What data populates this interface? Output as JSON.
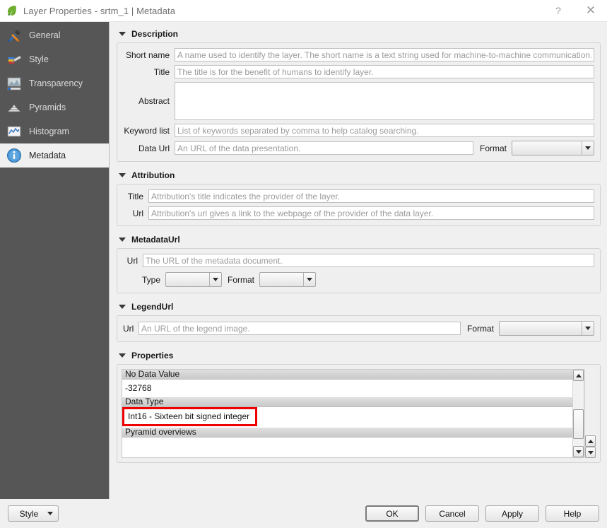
{
  "window": {
    "title": "Layer Properties - srtm_1 | Metadata",
    "icon": "qgis-leaf-icon",
    "help_button": "?",
    "close_button": "✕"
  },
  "sidebar": {
    "items": [
      {
        "label": "General",
        "icon": "hammer-screwdriver-icon",
        "selected": false
      },
      {
        "label": "Style",
        "icon": "paintbrush-icon",
        "selected": false
      },
      {
        "label": "Transparency",
        "icon": "transparency-icon",
        "selected": false
      },
      {
        "label": "Pyramids",
        "icon": "pyramid-icon",
        "selected": false
      },
      {
        "label": "Histogram",
        "icon": "histogram-icon",
        "selected": false
      },
      {
        "label": "Metadata",
        "icon": "info-icon",
        "selected": true
      }
    ]
  },
  "sections": {
    "description": {
      "title": "Description",
      "short_name_label": "Short name",
      "short_name_placeholder": "A name used to identify the layer. The short name is a text string used for machine-to-machine communication.",
      "short_name_value": "",
      "title_label": "Title",
      "title_placeholder": "The title is for the benefit of humans to identify layer.",
      "title_value": "",
      "abstract_label": "Abstract",
      "abstract_value": "",
      "keyword_label": "Keyword list",
      "keyword_placeholder": "List of keywords separated by comma to help catalog searching.",
      "keyword_value": "",
      "data_url_label": "Data Url",
      "data_url_placeholder": "An URL of the data presentation.",
      "data_url_value": "",
      "format_label": "Format",
      "format_value": ""
    },
    "attribution": {
      "title": "Attribution",
      "title_label": "Title",
      "title_placeholder": "Attribution's title indicates the provider of the layer.",
      "title_value": "",
      "url_label": "Url",
      "url_placeholder": "Attribution's url gives a link to the webpage of the provider of the data layer.",
      "url_value": ""
    },
    "metadata_url": {
      "title": "MetadataUrl",
      "url_label": "Url",
      "url_placeholder": "The URL of the metadata document.",
      "url_value": "",
      "type_label": "Type",
      "type_value": "",
      "format_label": "Format",
      "format_value": ""
    },
    "legend_url": {
      "title": "LegendUrl",
      "url_label": "Url",
      "url_placeholder": "An URL of the legend image.",
      "url_value": "",
      "format_label": "Format",
      "format_value": ""
    },
    "properties": {
      "title": "Properties",
      "rows": [
        {
          "header": "No Data Value",
          "value": "-32768",
          "highlighted": false
        },
        {
          "header": "Data Type",
          "value": "Int16 - Sixteen bit signed integer",
          "highlighted": true
        },
        {
          "header": "Pyramid overviews",
          "value": "",
          "highlighted": false
        }
      ]
    }
  },
  "buttons": {
    "style": "Style",
    "ok": "OK",
    "cancel": "Cancel",
    "apply": "Apply",
    "help": "Help"
  },
  "colors": {
    "sidebar_bg": "#565656",
    "dialog_bg": "#f0f0f0",
    "highlight_red": "#ee0000",
    "accent_blue": "#3b87c8"
  }
}
